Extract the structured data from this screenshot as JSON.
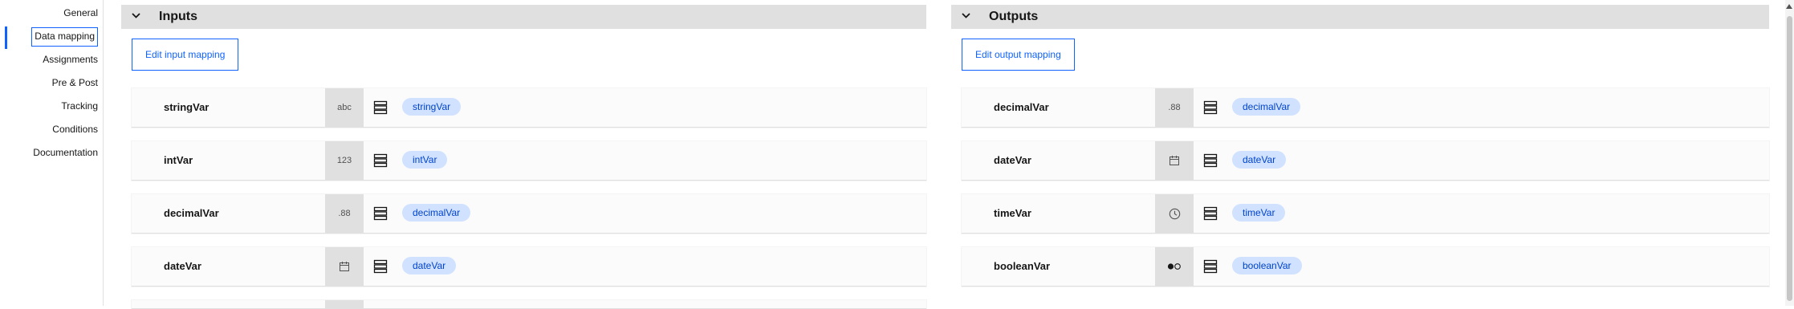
{
  "nav": {
    "items": [
      {
        "label": "General",
        "active": false
      },
      {
        "label": "Data mapping",
        "active": true
      },
      {
        "label": "Assignments",
        "active": false
      },
      {
        "label": "Pre & Post",
        "active": false
      },
      {
        "label": "Tracking",
        "active": false
      },
      {
        "label": "Conditions",
        "active": false
      },
      {
        "label": "Documentation",
        "active": false
      }
    ]
  },
  "inputs": {
    "title": "Inputs",
    "edit_label": "Edit input mapping",
    "rows": [
      {
        "name": "stringVar",
        "type_icon": "text-type-icon",
        "type_text": "abc",
        "mapping": "stringVar"
      },
      {
        "name": "intVar",
        "type_icon": "integer-type-icon",
        "type_text": "123",
        "mapping": "intVar"
      },
      {
        "name": "decimalVar",
        "type_icon": "decimal-type-icon",
        "type_text": ".88",
        "mapping": "decimalVar"
      },
      {
        "name": "dateVar",
        "type_icon": "calendar-icon",
        "type_text": "",
        "mapping": "dateVar"
      }
    ]
  },
  "outputs": {
    "title": "Outputs",
    "edit_label": "Edit output mapping",
    "rows": [
      {
        "name": "decimalVar",
        "type_icon": "decimal-type-icon",
        "type_text": ".88",
        "mapping": "decimalVar"
      },
      {
        "name": "dateVar",
        "type_icon": "calendar-icon",
        "type_text": "",
        "mapping": "dateVar"
      },
      {
        "name": "timeVar",
        "type_icon": "clock-icon",
        "type_text": "",
        "mapping": "timeVar"
      },
      {
        "name": "booleanVar",
        "type_icon": "boolean-toggle-icon",
        "type_text": "",
        "mapping": "booleanVar"
      }
    ]
  },
  "colors": {
    "accent": "#0f62fe",
    "pill_bg": "#d0e2ff",
    "pill_text": "#0043ce",
    "header_bg": "#e0e0e0"
  }
}
